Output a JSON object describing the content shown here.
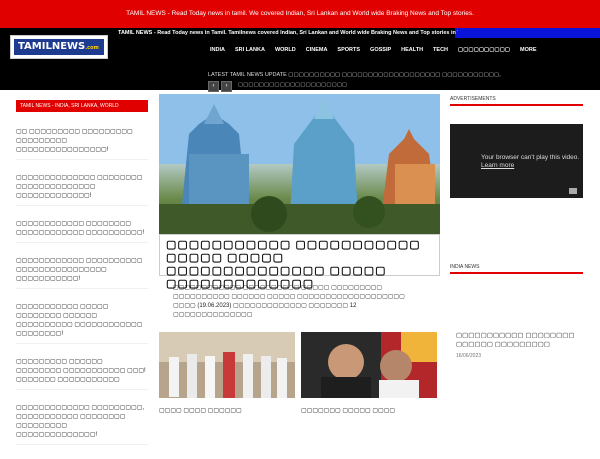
{
  "topbar": {
    "text": "TAMIL NEWS - Read Today news in tamil. We covered Indian, Sri Lankan and World wide Braking News and Top stories."
  },
  "header": {
    "logo_text": "TAMILNEWS",
    "logo_suffix": ".com",
    "tagline": "TAMIL NEWS - Read Today news in Tamil. Tamilnews covered Indian, Sri Lankan and World wide Braking News and Top stories in Tamil & English Language.",
    "nav": [
      "INDIA",
      "SRI LANKA",
      "WORLD",
      "CINEMA",
      "SPORTS",
      "GOSSIP",
      "HEALTH",
      "TECH",
      "▢▢▢▢▢▢▢▢▢▢",
      "MORE"
    ],
    "ticker": "LATEST TAMIL NEWS UPDATE   ▢▢▢▢▢▢▢▢▢▢ ▢▢▢▢▢▢▢▢▢▢▢▢▢▢▢▢▢▢▢ ▢▢▢▢▢▢▢▢▢▢▢,",
    "ticker_title": "▢▢▢▢▢▢▢▢▢▢▢▢▢▢▢▢▢▢▢▢▢",
    "prev_label": "‹",
    "next_label": "›"
  },
  "left": {
    "heading": "TAMIL NEWS - INDIA, SRI LANKA, WORLD",
    "items": [
      "▢▢ ▢▢▢▢▢▢▢▢▢ ▢▢▢▢▢▢▢▢▢ ▢▢▢▢▢▢▢▢▢ ▢▢▢▢▢▢▢▢▢▢▢▢▢▢▢▢!",
      "▢▢▢▢▢▢▢▢▢▢▢▢▢▢ ▢▢▢▢▢▢▢▢ ▢▢▢▢▢▢▢▢▢▢▢▢▢▢ ▢▢▢▢▢▢▢▢▢▢▢▢▢!",
      "▢▢▢▢▢▢▢▢▢▢▢▢ ▢▢▢▢▢▢▢▢ ▢▢▢▢▢▢▢▢▢▢▢▢ ▢▢▢▢▢▢▢▢▢▢!",
      "▢▢▢▢▢▢▢▢▢▢▢▢ ▢▢▢▢▢▢▢▢▢▢ ▢▢▢▢▢▢▢▢▢▢▢▢▢▢▢▢ ▢▢▢▢▢▢▢▢▢▢▢!",
      "▢▢▢▢▢▢▢▢▢▢▢ ▢▢▢▢▢ ▢▢▢▢▢▢▢▢ ▢▢▢▢▢▢ ▢▢▢▢▢▢▢▢▢▢ ▢▢▢▢▢▢▢▢▢▢▢▢ ▢▢▢▢▢▢▢▢!",
      "▢▢▢▢▢▢▢▢▢ ▢▢▢▢▢▢ ▢▢▢▢▢▢▢▢ ▢▢▢▢▢▢▢▢▢▢▢ ▢▢▢! ▢▢▢▢▢▢▢ ▢▢▢▢▢▢▢▢▢▢▢",
      "▢▢▢▢▢▢▢▢▢▢▢▢▢ ▢▢▢▢▢▢▢▢▢, ▢▢▢▢▢▢▢▢▢▢▢ ▢▢▢▢▢▢▢▢ ▢▢▢▢▢▢▢▢▢ ▢▢▢▢▢▢▢▢▢▢▢▢▢▢!"
    ]
  },
  "main": {
    "hero_title": "▢▢▢▢▢▢▢▢▢▢▢ ▢▢▢▢▢▢▢▢▢▢▢ ▢▢▢▢▢ ▢▢▢▢▢ ▢▢▢▢▢▢▢▢▢▢▢▢▢▢ ▢▢▢▢▢ ▢▢▢▢▢▢▢▢▢▢▢▢▢",
    "hero_excerpt": "▢▢▢▢▢▢▢▢▢▢▢▢ ▢▢▢▢▢▢▢▢▢▢ ▢▢▢▢▢ ▢▢▢▢▢▢▢▢▢ ▢▢▢▢▢▢▢▢▢▢ ▢▢▢▢▢▢ ▢▢▢▢▢ ▢▢▢▢▢▢▢▢▢▢▢▢▢▢▢▢▢▢▢ ▢▢▢▢ (19.06.2023) ▢▢▢▢▢▢▢▢▢▢▢▢▢ ▢▢▢▢▢▢▢ 12 ▢▢▢▢▢▢▢▢▢▢▢▢▢▢",
    "cards": [
      {
        "title": "▢▢▢▢ ▢▢▢▢ ▢▢▢▢▢▢"
      },
      {
        "title": "▢▢▢▢▢▢▢ ▢▢▢▢▢ ▢▢▢▢"
      }
    ]
  },
  "right": {
    "ad_heading": "ADVERTISEMENTS",
    "video_message": "Your browser can't play this video.",
    "video_link": "Learn more",
    "india_heading": "INDIA NEWS",
    "india_title": "▢▢▢▢▢▢▢▢▢▢▢ ▢▢▢▢▢▢▢▢ ▢▢▢▢▢▢ ▢▢▢▢▢▢▢▢▢",
    "india_date": "16/06/2023"
  },
  "colors": {
    "accent": "#e00000",
    "header_bg": "#000000",
    "nav_fill": "#0a14d8",
    "logo_bg": "#1d3c8f"
  }
}
